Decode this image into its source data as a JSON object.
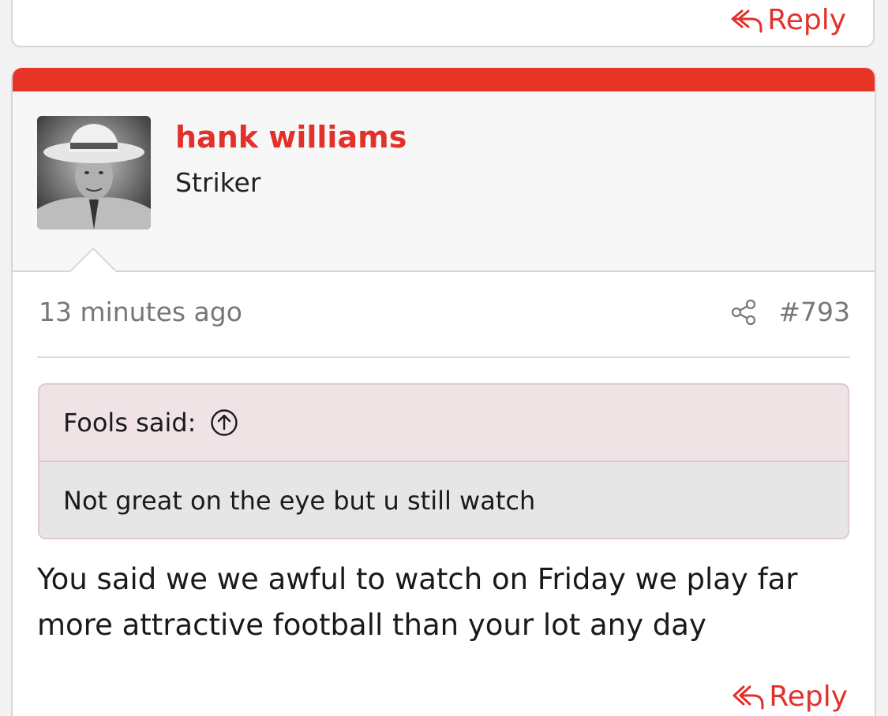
{
  "prev_post": {
    "reply_label": "Reply"
  },
  "post": {
    "author": {
      "name": "hank williams",
      "title": "Striker"
    },
    "timestamp": "13 minutes ago",
    "post_number": "#793",
    "quote": {
      "author_said": "Fools said:",
      "text": "Not great on the eye but u still watch"
    },
    "body": "You said we we awful to watch on Friday we play far more attractive football than your lot any day",
    "reply_label": "Reply"
  },
  "colors": {
    "accent": "#e63426",
    "link": "#e2312a",
    "quote_header_bg": "#efe3e6",
    "quote_body_bg": "#e6e6e6"
  },
  "icons": {
    "share": "share-icon",
    "quote_jump": "arrow-up-circle-icon",
    "reply": "reply-arrow-icon"
  }
}
